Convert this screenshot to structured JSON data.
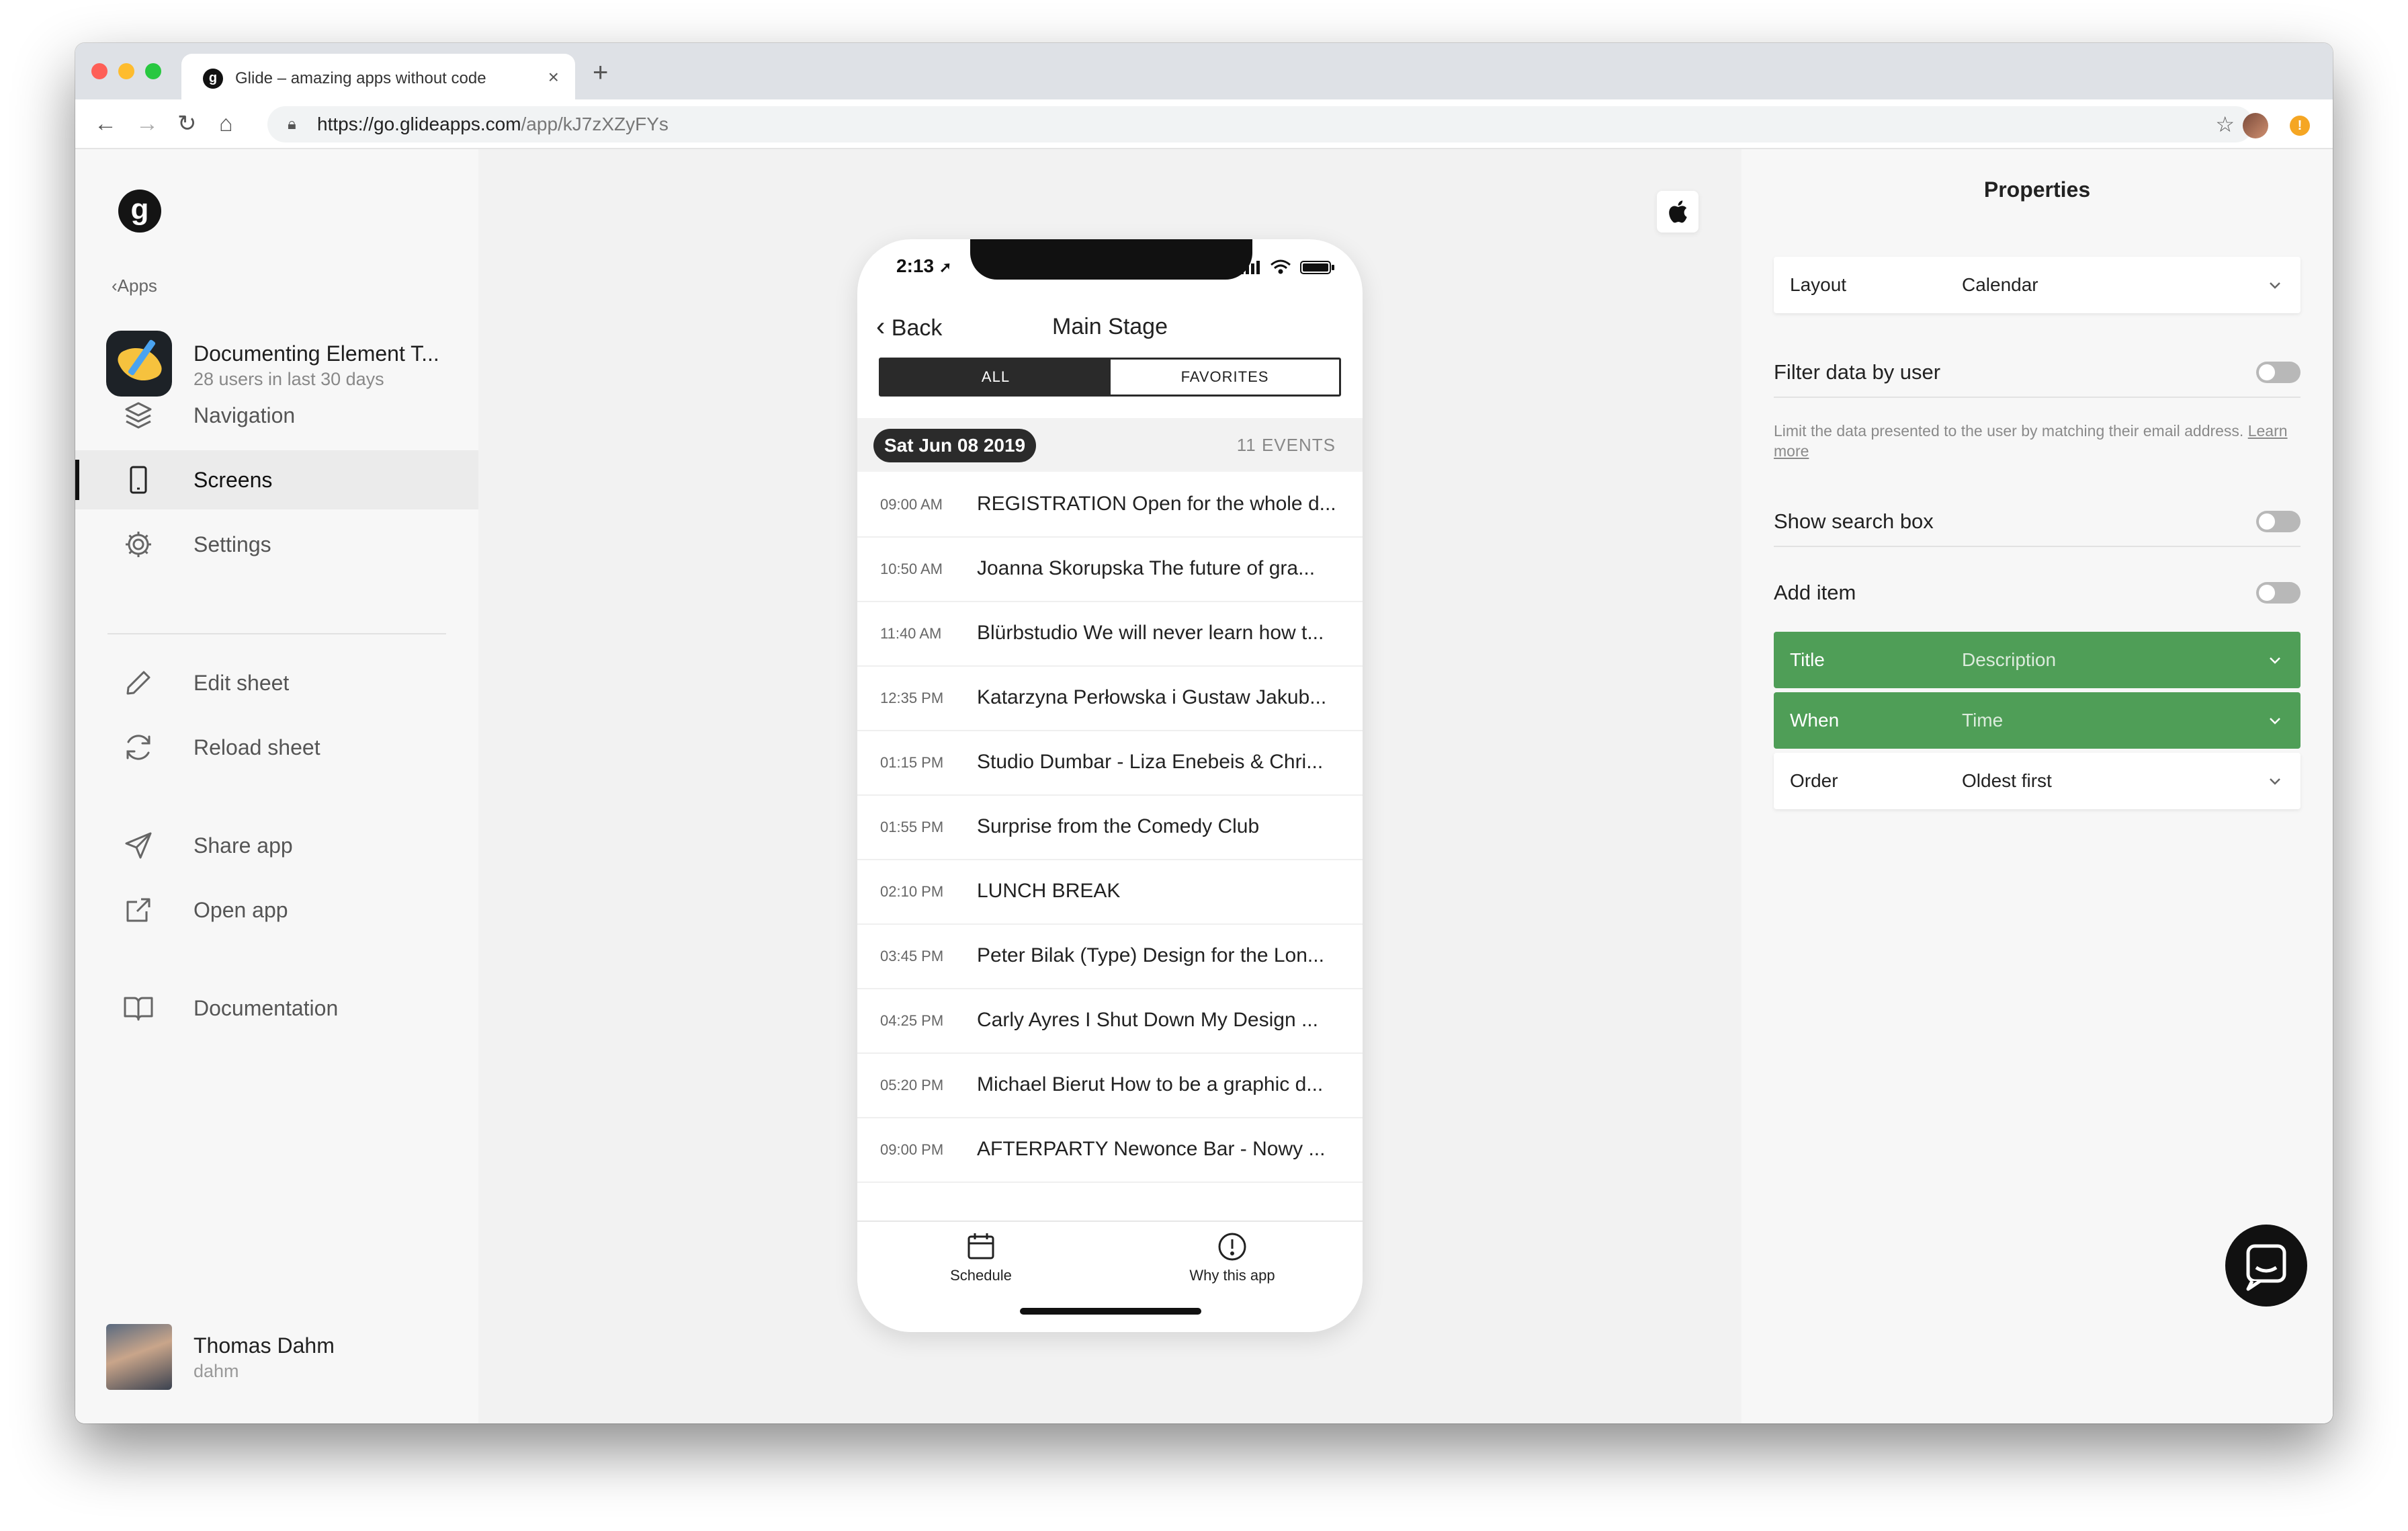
{
  "browser": {
    "tab_title": "Glide – amazing apps without code",
    "tab_favicon": "g",
    "new_tab": "+",
    "url_host": "https://go.glideapps.com",
    "url_path": "/app/kJ7zXZyFYs"
  },
  "sidebar": {
    "logo": "g",
    "back_label": "Apps",
    "app": {
      "name": "Documenting Element T...",
      "users": "28 users in last 30 days"
    },
    "items": [
      {
        "label": "Navigation",
        "icon": "layers-icon"
      },
      {
        "label": "Screens",
        "icon": "phone-icon",
        "active": true
      },
      {
        "label": "Settings",
        "icon": "gear-icon"
      },
      {
        "label": "Edit sheet",
        "icon": "pencil-icon"
      },
      {
        "label": "Reload sheet",
        "icon": "refresh-icon"
      },
      {
        "label": "Share app",
        "icon": "send-icon"
      },
      {
        "label": "Open app",
        "icon": "external-link-icon"
      },
      {
        "label": "Documentation",
        "icon": "book-icon"
      }
    ],
    "user": {
      "name": "Thomas Dahm",
      "handle": "dahm"
    }
  },
  "phone": {
    "time": "2:13",
    "back_label": "Back",
    "title": "Main Stage",
    "segments": {
      "all": "ALL",
      "favorites": "FAVORITES"
    },
    "date_pill": "Sat Jun 08 2019",
    "event_count": "11 EVENTS",
    "events": [
      {
        "time": "09:00 AM",
        "title": "REGISTRATION Open for the whole d..."
      },
      {
        "time": "10:50 AM",
        "title": "Joanna Skorupska The future of gra..."
      },
      {
        "time": "11:40 AM",
        "title": "Blürbstudio We will never learn how t..."
      },
      {
        "time": "12:35 PM",
        "title": "Katarzyna Perłowska i Gustaw Jakub..."
      },
      {
        "time": "01:15 PM",
        "title": "Studio Dumbar - Liza Enebeis & Chri..."
      },
      {
        "time": "01:55 PM",
        "title": "Surprise from the Comedy Club"
      },
      {
        "time": "02:10 PM",
        "title": "LUNCH BREAK"
      },
      {
        "time": "03:45 PM",
        "title": "Peter Bilak (Type) Design for the Lon..."
      },
      {
        "time": "04:25 PM",
        "title": "Carly Ayres I Shut Down My Design ..."
      },
      {
        "time": "05:20 PM",
        "title": "Michael Bierut How to be a graphic d..."
      },
      {
        "time": "09:00 PM",
        "title": "AFTERPARTY Newonce Bar - Nowy ..."
      }
    ],
    "tabs": [
      {
        "label": "Schedule",
        "icon": "calendar-icon"
      },
      {
        "label": "Why this app",
        "icon": "info-circle-icon"
      }
    ]
  },
  "properties": {
    "title": "Properties",
    "layout": {
      "label": "Layout",
      "value": "Calendar"
    },
    "filter_by_user": {
      "label": "Filter data by user",
      "help": "Limit the data presented to the user by matching their email address.",
      "link": "Learn more"
    },
    "show_search": {
      "label": "Show search box"
    },
    "add_item": {
      "label": "Add item"
    },
    "title_field": {
      "label": "Title",
      "value": "Description"
    },
    "when_field": {
      "label": "When",
      "value": "Time"
    },
    "order_field": {
      "label": "Order",
      "value": "Oldest first"
    }
  },
  "colors": {
    "accent_green": "#4f9e57",
    "dark": "#2a2a2a"
  }
}
